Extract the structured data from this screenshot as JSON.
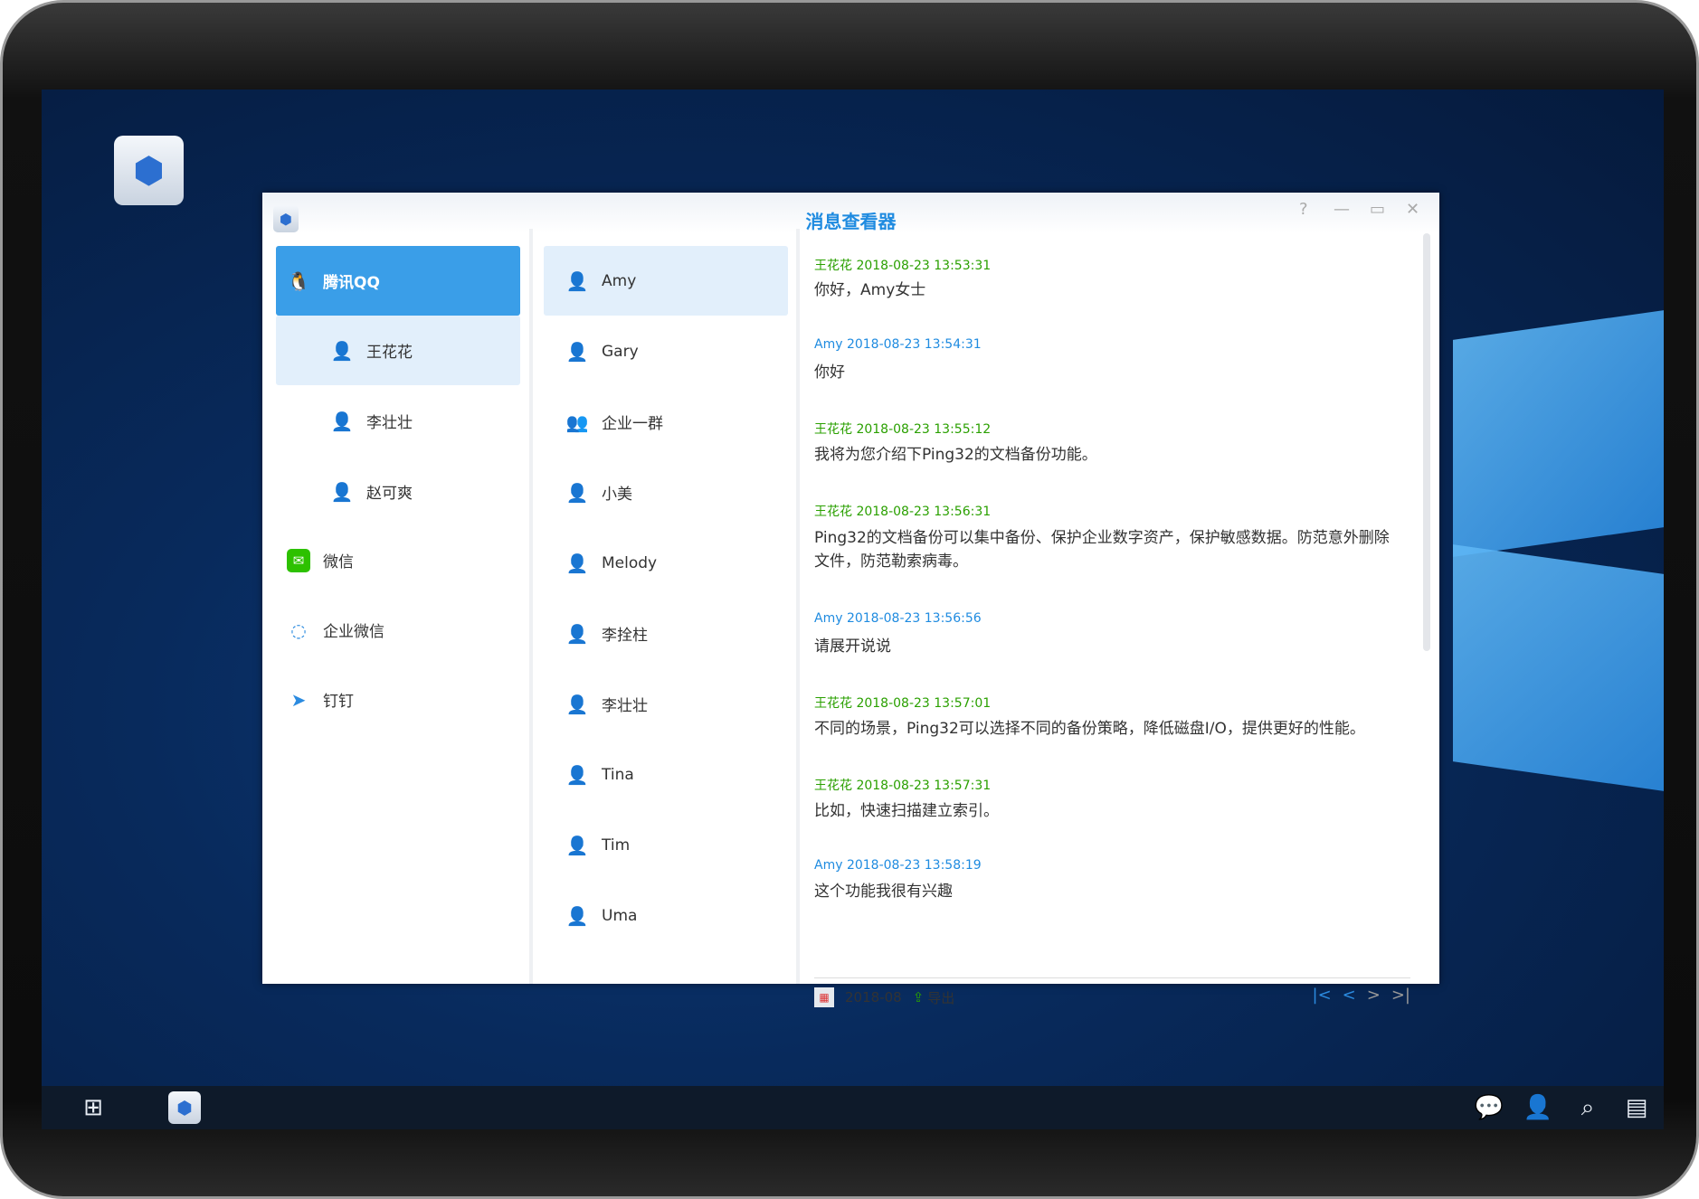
{
  "window": {
    "title": "消息查看器",
    "controls": [
      "?",
      "—",
      "▭",
      "✕"
    ]
  },
  "platforms": [
    {
      "label": "腾讯QQ",
      "icon": "qq-penguin-icon",
      "active": true,
      "accounts": [
        {
          "label": "王花花",
          "selected": true
        },
        {
          "label": "李壮壮"
        },
        {
          "label": "赵可爽"
        }
      ]
    },
    {
      "label": "微信",
      "icon": "wechat-icon",
      "color": "#2dc100"
    },
    {
      "label": "企业微信",
      "icon": "wecom-icon",
      "color": "#2b8be0"
    },
    {
      "label": "钉钉",
      "icon": "dingtalk-icon",
      "color": "#2b8be0"
    }
  ],
  "contacts": [
    {
      "label": "Amy",
      "selected": true
    },
    {
      "label": "Gary"
    },
    {
      "label": "企业一群",
      "group": true
    },
    {
      "label": "小美"
    },
    {
      "label": "Melody"
    },
    {
      "label": "李拴柱"
    },
    {
      "label": "李壮壮"
    },
    {
      "label": "Tina"
    },
    {
      "label": "Tim"
    },
    {
      "label": "Uma"
    }
  ],
  "messages": [
    {
      "sender": "王花花",
      "time": "2018-08-23 13:53:31",
      "text": "你好，Amy女士"
    },
    {
      "sender": "Amy",
      "time": "2018-08-23 13:54:31",
      "text": "你好"
    },
    {
      "sender": "王花花",
      "time": "2018-08-23 13:55:12",
      "text": "我将为您介绍下Ping32的文档备份功能。"
    },
    {
      "sender": "王花花",
      "time": "2018-08-23 13:56:31",
      "text": "Ping32的文档备份可以集中备份、保护企业数字资产，保护敏感数据。防范意外删除文件，防范勒索病毒。"
    },
    {
      "sender": "Amy",
      "time": "2018-08-23 13:56:56",
      "text": "请展开说说"
    },
    {
      "sender": "王花花",
      "time": "2018-08-23 13:57:01",
      "text": "不同的场景，Ping32可以选择不同的备份策略，降低磁盘I/O，提供更好的性能。"
    },
    {
      "sender": "王花花",
      "time": "2018-08-23 13:57:31",
      "text": "比如，快速扫描建立索引。"
    },
    {
      "sender": "Amy",
      "time": "2018-08-23 13:58:19",
      "text": "这个功能我很有兴趣"
    }
  ],
  "footer": {
    "month": "2018-08",
    "export_label": "导出",
    "pager": [
      "|<",
      "<",
      ">",
      ">|"
    ]
  },
  "colors": {
    "accent": "#3a9ee8",
    "self_sender": "#2aa000",
    "other_sender": "#1f8be0",
    "selected_bg": "#e2effb"
  }
}
